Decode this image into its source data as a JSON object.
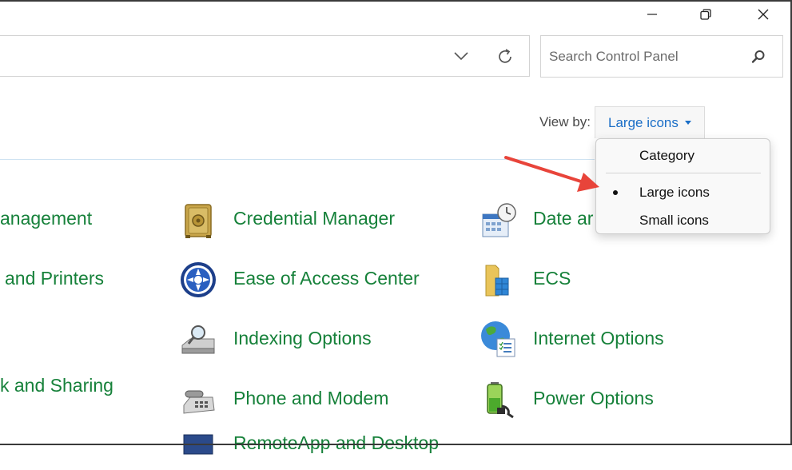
{
  "window": {
    "minimize_icon": "minimize-icon",
    "maximize_icon": "restore-icon",
    "close_icon": "close-icon"
  },
  "address_bar": {
    "dropdown_icon": "chevron-down-icon",
    "refresh_icon": "refresh-icon"
  },
  "search": {
    "placeholder": "Search Control Panel",
    "icon": "search-icon"
  },
  "view_by": {
    "label": "View by:",
    "selected": "Large icons",
    "options": [
      {
        "label": "Category",
        "selected": false
      },
      {
        "label": "Large icons",
        "selected": true
      },
      {
        "label": "Small icons",
        "selected": false
      }
    ]
  },
  "items": {
    "col1": [
      {
        "label": "anagement"
      },
      {
        "label": "and Printers"
      },
      {
        "label": "k and Sharing"
      }
    ],
    "col2": [
      {
        "label": "Credential Manager",
        "icon": "safe-icon"
      },
      {
        "label": "Ease of Access Center",
        "icon": "accessibility-icon"
      },
      {
        "label": "Indexing Options",
        "icon": "indexing-icon"
      },
      {
        "label": "Phone and Modem",
        "icon": "phone-icon"
      },
      {
        "label": "RemoteApp and Desktop",
        "icon": "remoteapp-icon"
      }
    ],
    "col3": [
      {
        "label": "Date ar",
        "icon": "calendar-clock-icon"
      },
      {
        "label": "ECS",
        "icon": "folder-icon"
      },
      {
        "label": "Internet Options",
        "icon": "globe-icon"
      },
      {
        "label": "Power Options",
        "icon": "battery-icon"
      }
    ]
  },
  "colors": {
    "item_text": "#16813a",
    "link_blue": "#1a6ec7",
    "arrow_red": "#e8443a"
  }
}
